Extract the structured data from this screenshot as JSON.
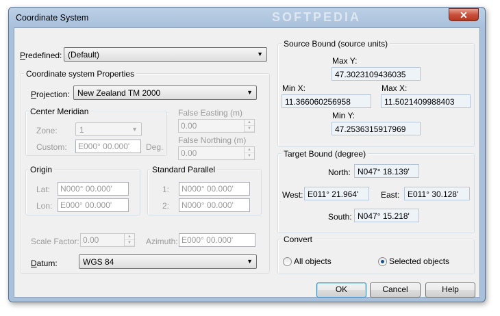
{
  "window": {
    "title": "Coordinate System",
    "watermark": "SOFTPEDIA",
    "close": "✕"
  },
  "predefined": {
    "label": "Predefined:",
    "value": "(Default)"
  },
  "csp": {
    "title": "Coordinate system Properties",
    "projection_label": "Projection:",
    "projection_value": "New Zealand TM 2000",
    "center_meridian": {
      "title": "Center Meridian",
      "zone_label": "Zone:",
      "zone_value": "1",
      "custom_label": "Custom:",
      "custom_value": "E000° 00.000'",
      "deg": "Deg."
    },
    "false_easting": {
      "label": "False Easting (m)",
      "value": "0.00"
    },
    "false_northing": {
      "label": "False Northing (m)",
      "value": "0.00"
    },
    "origin": {
      "title": "Origin",
      "lat_label": "Lat:",
      "lat_value": "N000° 00.000'",
      "lon_label": "Lon:",
      "lon_value": "E000° 00.000'"
    },
    "standard_parallel": {
      "title": "Standard Parallel",
      "p1_label": "1:",
      "p1_value": "N000° 00.000'",
      "p2_label": "2:",
      "p2_value": "N000° 00.000'"
    },
    "scale_factor": {
      "label": "Scale Factor:",
      "value": "0.00"
    },
    "azimuth": {
      "label": "Azimuth:",
      "value": "E000° 00.000'"
    },
    "datum": {
      "label": "Datum:",
      "value": "WGS 84"
    }
  },
  "source_bound": {
    "title": "Source Bound (source units)",
    "max_y_label": "Max Y:",
    "max_y": "47.3023109436035",
    "min_x_label": "Min X:",
    "min_x": "11.366060256958",
    "max_x_label": "Max X:",
    "max_x": "11.5021409988403",
    "min_y_label": "Min Y:",
    "min_y": "47.2536315917969"
  },
  "target_bound": {
    "title": "Target Bound (degree)",
    "north_label": "North:",
    "north": "N047° 18.139'",
    "west_label": "West:",
    "west": "E011° 21.964'",
    "east_label": "East:",
    "east": "E011° 30.128'",
    "south_label": "South:",
    "south": "N047° 15.218'"
  },
  "convert": {
    "title": "Convert",
    "all_label": "All objects",
    "selected_label": "Selected objects",
    "selected": "Selected objects"
  },
  "buttons": {
    "ok": "OK",
    "cancel": "Cancel",
    "help": "Help"
  }
}
